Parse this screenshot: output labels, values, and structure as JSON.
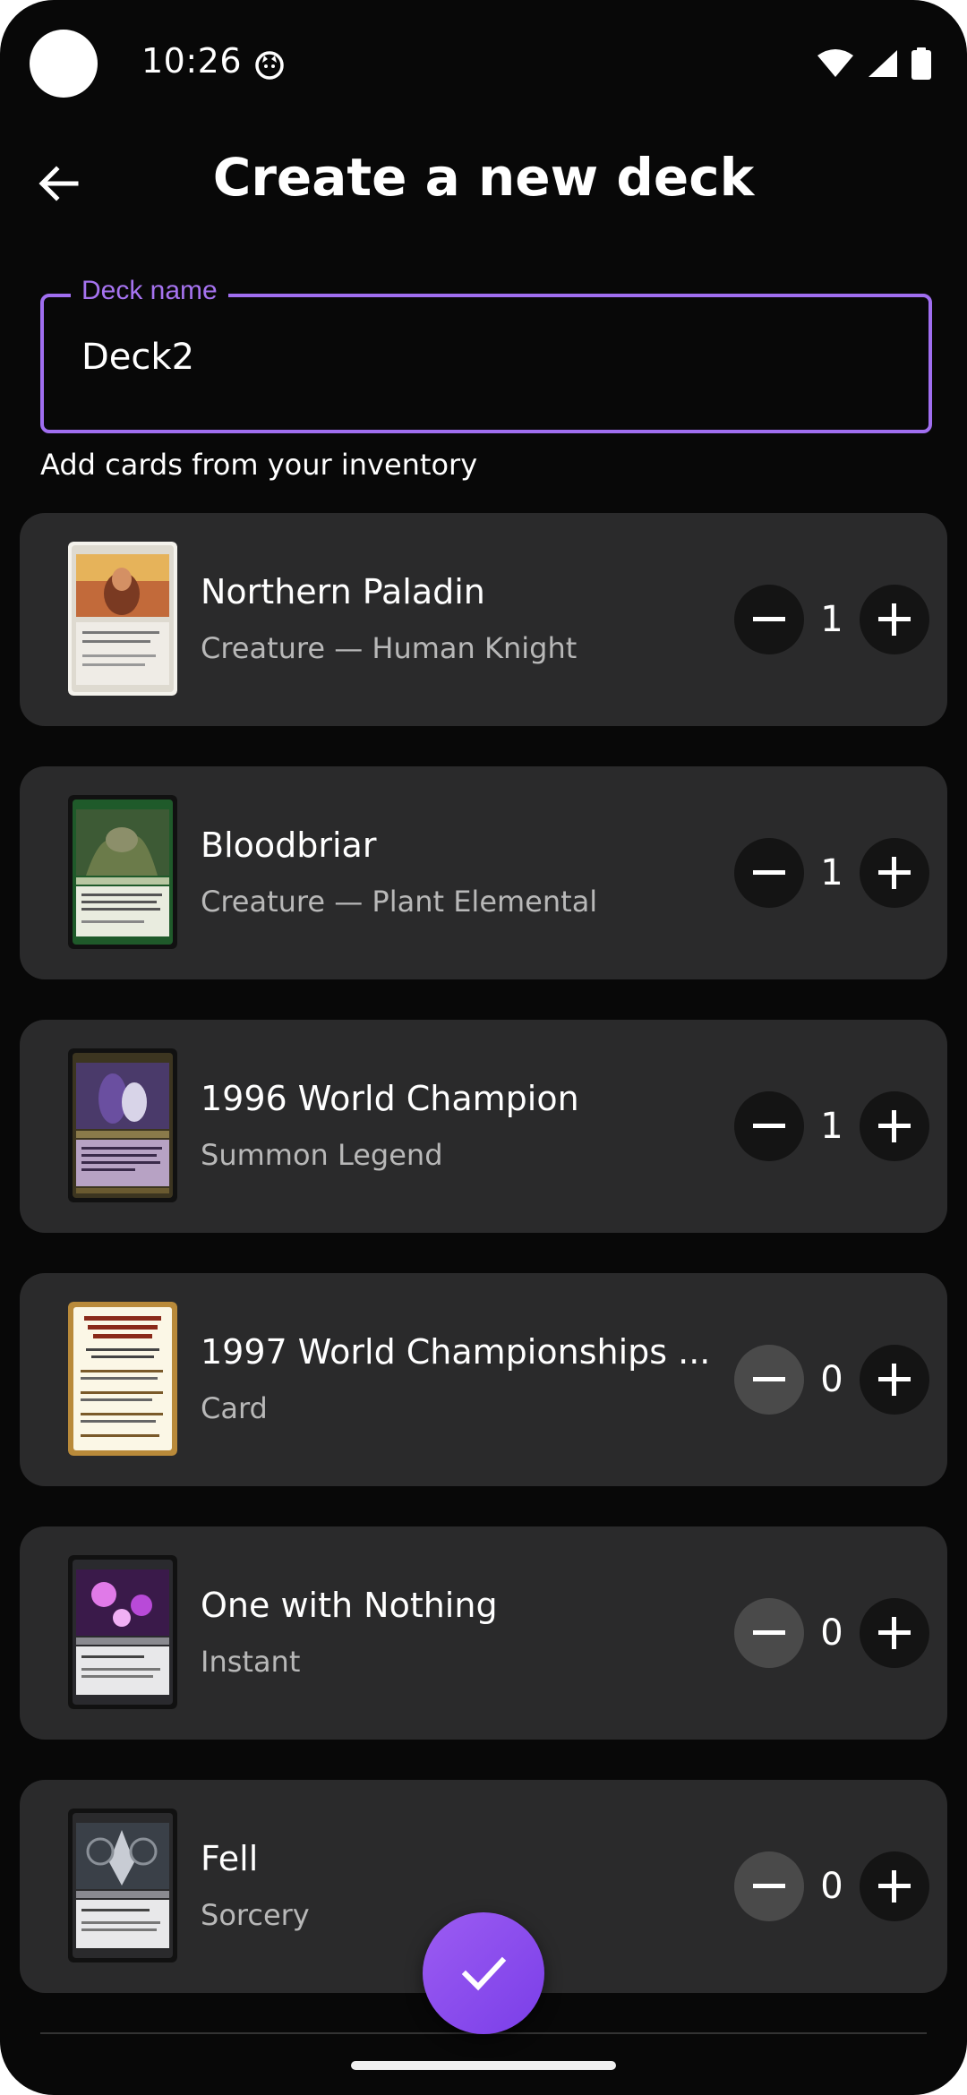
{
  "status_bar": {
    "time": "10:26",
    "icons": [
      "app-notification-icon",
      "wifi-icon",
      "signal-icon",
      "battery-icon"
    ]
  },
  "header": {
    "title": "Create a new deck",
    "back_icon": "arrow-back-icon"
  },
  "deck_name": {
    "label": "Deck name",
    "value": "Deck2"
  },
  "helper_text": "Add cards from your inventory",
  "cards": [
    {
      "name": "Northern Paladin",
      "type": "Creature — Human Knight",
      "count": "1",
      "decrement_enabled": true
    },
    {
      "name": "Bloodbriar",
      "type": "Creature — Plant Elemental",
      "count": "1",
      "decrement_enabled": true
    },
    {
      "name": "1996 World Champion",
      "type": "Summon Legend",
      "count": "1",
      "decrement_enabled": true
    },
    {
      "name": "1997 World Championships ...",
      "type": "Card",
      "count": "0",
      "decrement_enabled": false
    },
    {
      "name": "One with Nothing",
      "type": "Instant",
      "count": "0",
      "decrement_enabled": false
    },
    {
      "name": "Fell",
      "type": "Sorcery",
      "count": "0",
      "decrement_enabled": false
    }
  ],
  "fab": {
    "icon": "check-icon"
  },
  "colors": {
    "accent": "#a06ef0",
    "background": "#080808",
    "card_bg": "#2a2a2b",
    "fab": "#8a4cee"
  }
}
